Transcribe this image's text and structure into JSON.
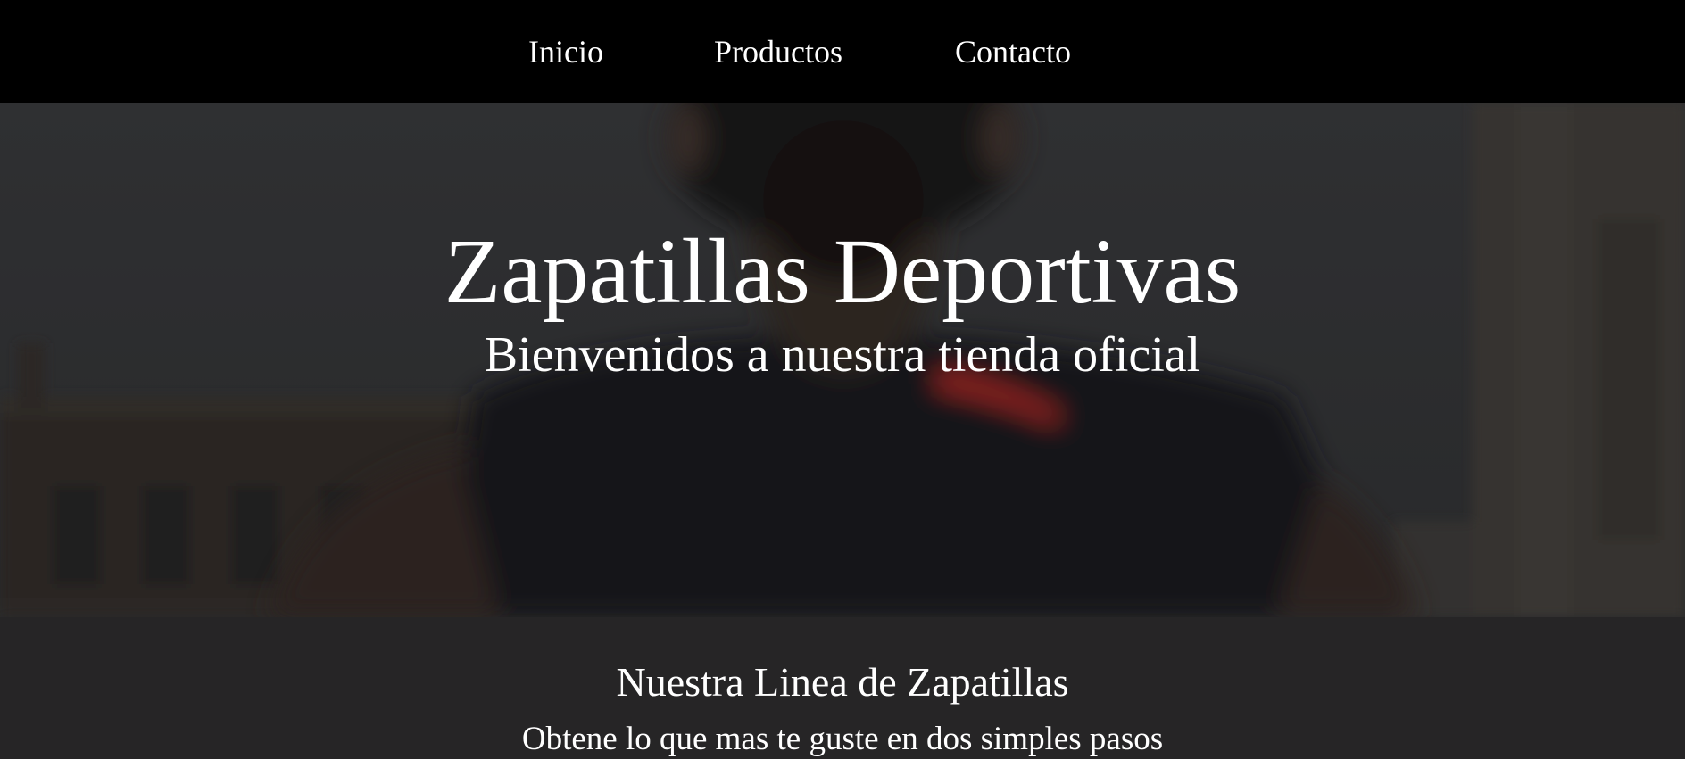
{
  "nav": {
    "items": [
      {
        "label": "Inicio"
      },
      {
        "label": "Productos"
      },
      {
        "label": "Contacto"
      }
    ]
  },
  "hero": {
    "title": "Zapatillas Deportivas",
    "subtitle": "Bienvenidos a nuestra tienda oficial"
  },
  "section": {
    "title": "Nuestra Linea de Zapatillas",
    "text": "Obtene lo que mas te guste en dos simples pasos"
  },
  "colors": {
    "navbar_bg": "#000000",
    "section_bg": "#262526",
    "text": "#ffffff",
    "shirt_accent": "#c8312a"
  }
}
